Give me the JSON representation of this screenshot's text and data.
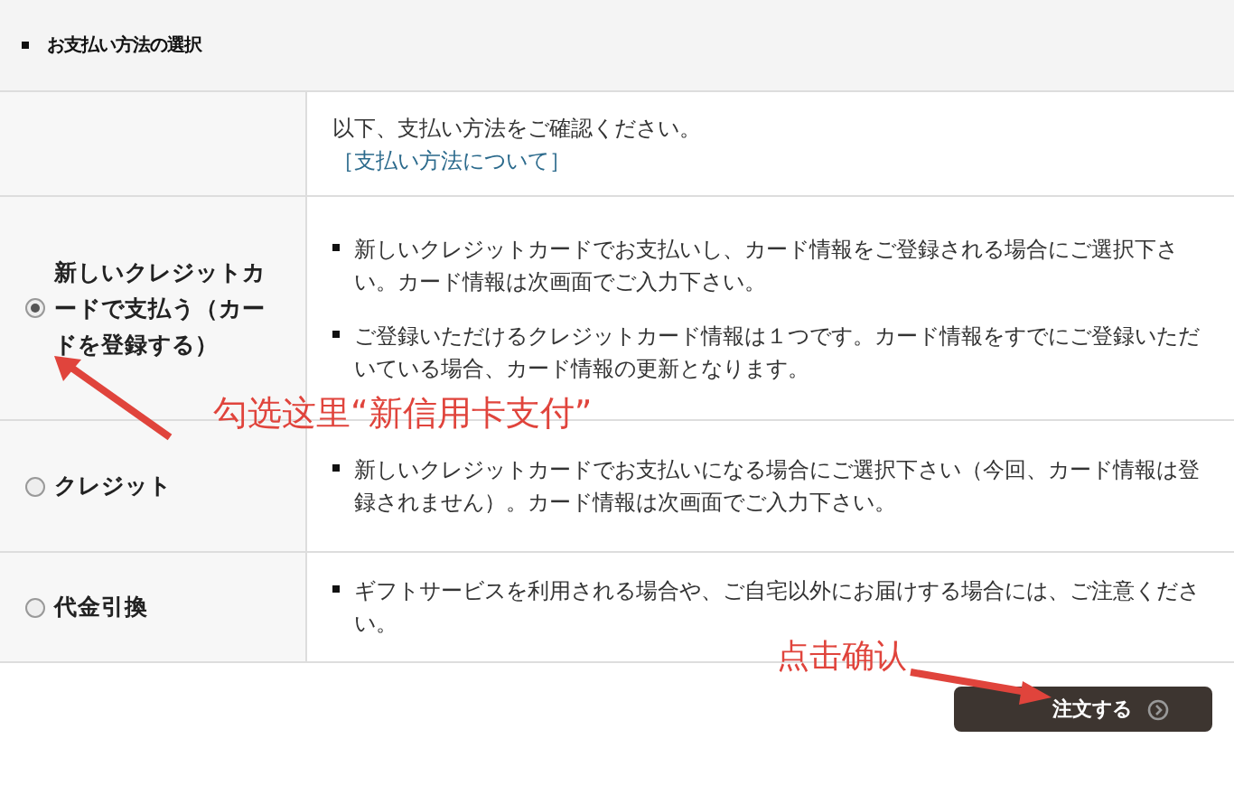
{
  "section_title": "お支払い方法の選択",
  "intro": {
    "text": "以下、支払い方法をご確認ください。",
    "link": "［支払い方法について］"
  },
  "methods": [
    {
      "label": "新しいクレジットカードで支払う（カードを登録する）",
      "selected": true,
      "notes": [
        "新しいクレジットカードでお支払いし、カード情報をご登録される場合にご選択下さい。カード情報は次画面でご入力下さい。",
        "ご登録いただけるクレジットカード情報は１つです。カード情報をすでにご登録いただいている場合、カード情報の更新となります。"
      ]
    },
    {
      "label": "クレジット",
      "selected": false,
      "notes": [
        "新しいクレジットカードでお支払いになる場合にご選択下さい（今回、カード情報は登録されません）。カード情報は次画面でご入力下さい。"
      ]
    },
    {
      "label": "代金引換",
      "selected": false,
      "notes": [
        "ギフトサービスを利用される場合や、ご自宅以外にお届けする場合には、ご注意ください。"
      ]
    }
  ],
  "order_button": {
    "label": "注文する"
  },
  "annotations": [
    {
      "text": "勾选这里“新信用卡支付”"
    },
    {
      "text": "点击确认"
    }
  ]
}
